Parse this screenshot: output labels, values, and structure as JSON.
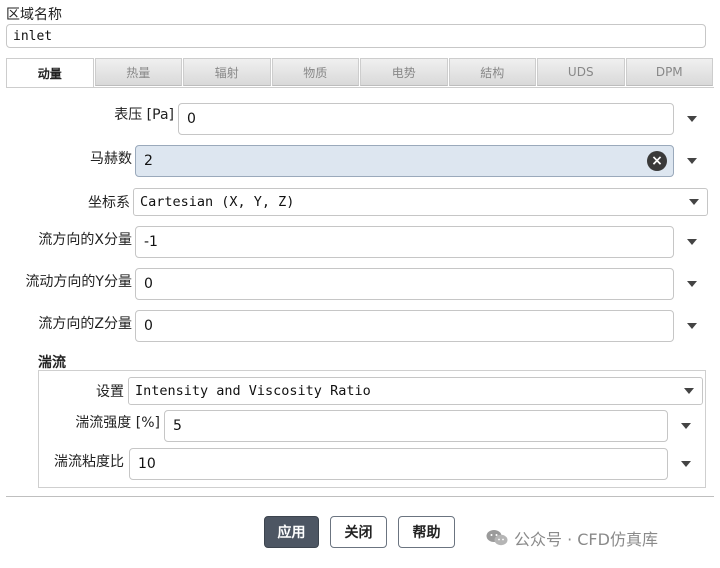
{
  "zone": {
    "label": "区域名称",
    "value": "inlet"
  },
  "tabs": [
    {
      "label": "动量",
      "active": true
    },
    {
      "label": "热量",
      "active": false
    },
    {
      "label": "辐射",
      "active": false
    },
    {
      "label": "物质",
      "active": false
    },
    {
      "label": "电势",
      "active": false
    },
    {
      "label": "結构",
      "active": false
    },
    {
      "label": "UDS",
      "active": false
    },
    {
      "label": "DPM",
      "active": false
    }
  ],
  "fields": {
    "pressure": {
      "label": "表压 [Pa]",
      "value": "0"
    },
    "mach": {
      "label": "马赫数",
      "value": "2"
    },
    "coord": {
      "label": "坐标系",
      "value": "Cartesian (X, Y, Z)"
    },
    "xcomp": {
      "label": "流方向的X分量",
      "value": "-1"
    },
    "ycomp": {
      "label": "流动方向的Y分量",
      "value": "0"
    },
    "zcomp": {
      "label": "流方向的Z分量",
      "value": "0"
    }
  },
  "turbulence": {
    "title": "湍流",
    "method": {
      "label": "设置",
      "value": "Intensity and Viscosity Ratio"
    },
    "intensity": {
      "label": "湍流强度 [%]",
      "value": "5"
    },
    "viscosity_ratio": {
      "label": "湍流粘度比",
      "value": "10"
    }
  },
  "buttons": {
    "apply": "应用",
    "close": "关闭",
    "help": "帮助"
  },
  "watermark": "公众号 · CFD仿真库"
}
